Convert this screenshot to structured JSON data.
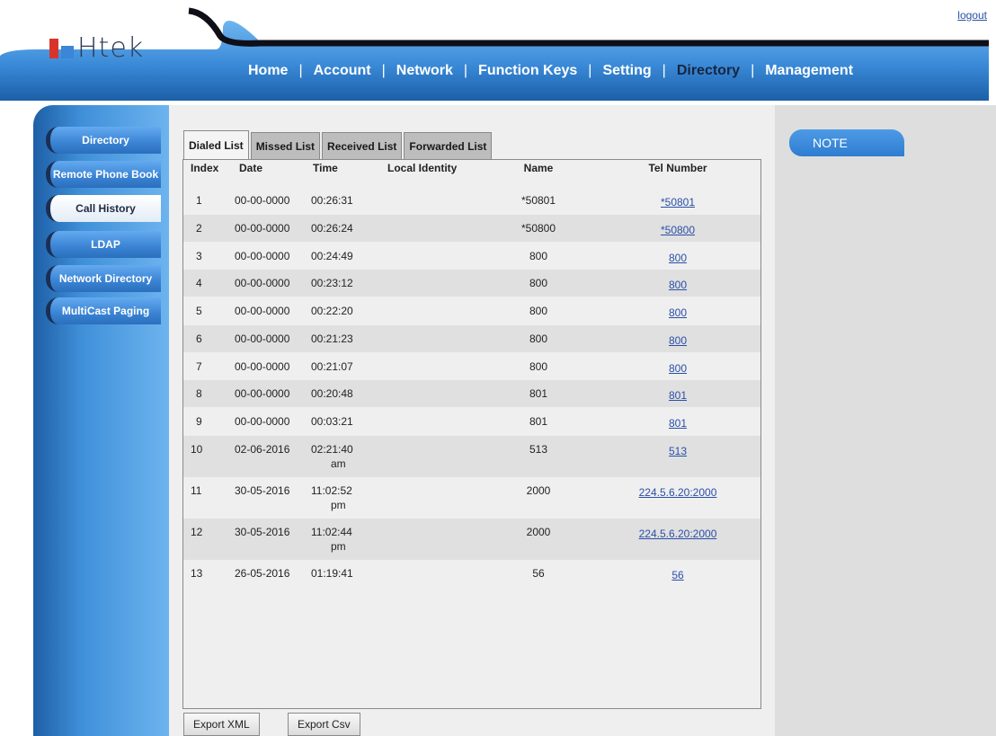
{
  "header": {
    "logo_text": "Htek",
    "logout": "logout",
    "nav": [
      {
        "label": "Home",
        "active": false
      },
      {
        "label": "Account",
        "active": false
      },
      {
        "label": "Network",
        "active": false
      },
      {
        "label": "Function Keys",
        "active": false
      },
      {
        "label": "Setting",
        "active": false
      },
      {
        "label": "Directory",
        "active": true
      },
      {
        "label": "Management",
        "active": false
      }
    ],
    "nav_separator": "|"
  },
  "sidebar": {
    "items": [
      {
        "label": "Directory",
        "active": false
      },
      {
        "label": "Remote Phone Book",
        "active": false
      },
      {
        "label": "Call History",
        "active": true
      },
      {
        "label": "LDAP",
        "active": false
      },
      {
        "label": "Network Directory",
        "active": false
      },
      {
        "label": "MultiCast Paging",
        "active": false
      }
    ]
  },
  "tabs": [
    {
      "label": "Dialed List",
      "active": true
    },
    {
      "label": "Missed List",
      "active": false
    },
    {
      "label": "Received List",
      "active": false
    },
    {
      "label": "Forwarded List",
      "active": false
    }
  ],
  "table": {
    "columns": {
      "index": "Index",
      "date": "Date",
      "time": "Time",
      "local": "Local Identity",
      "name": "Name",
      "tel": "Tel Number"
    },
    "rows": [
      {
        "index": "1",
        "date": "00-00-0000",
        "time": "00:26:31",
        "time2": "",
        "local": "",
        "name": "*50801",
        "tel": "*50801"
      },
      {
        "index": "2",
        "date": "00-00-0000",
        "time": "00:26:24",
        "time2": "",
        "local": "",
        "name": "*50800",
        "tel": "*50800"
      },
      {
        "index": "3",
        "date": "00-00-0000",
        "time": "00:24:49",
        "time2": "",
        "local": "",
        "name": "800",
        "tel": "800"
      },
      {
        "index": "4",
        "date": "00-00-0000",
        "time": "00:23:12",
        "time2": "",
        "local": "",
        "name": "800",
        "tel": "800"
      },
      {
        "index": "5",
        "date": "00-00-0000",
        "time": "00:22:20",
        "time2": "",
        "local": "",
        "name": "800",
        "tel": "800"
      },
      {
        "index": "6",
        "date": "00-00-0000",
        "time": "00:21:23",
        "time2": "",
        "local": "",
        "name": "800",
        "tel": "800"
      },
      {
        "index": "7",
        "date": "00-00-0000",
        "time": "00:21:07",
        "time2": "",
        "local": "",
        "name": "800",
        "tel": "800"
      },
      {
        "index": "8",
        "date": "00-00-0000",
        "time": "00:20:48",
        "time2": "",
        "local": "",
        "name": "801",
        "tel": "801"
      },
      {
        "index": "9",
        "date": "00-00-0000",
        "time": "00:03:21",
        "time2": "",
        "local": "",
        "name": "801",
        "tel": "801"
      },
      {
        "index": "10",
        "date": "02-06-2016",
        "time": "02:21:40",
        "time2": "am",
        "local": "",
        "name": "513",
        "tel": "513"
      },
      {
        "index": "11",
        "date": "30-05-2016",
        "time": "11:02:52",
        "time2": "pm",
        "local": "",
        "name": "2000",
        "tel": "224.5.6.20:2000"
      },
      {
        "index": "12",
        "date": "30-05-2016",
        "time": "11:02:44",
        "time2": "pm",
        "local": "",
        "name": "2000",
        "tel": "224.5.6.20:2000"
      },
      {
        "index": "13",
        "date": "26-05-2016",
        "time": "01:19:41",
        "time2": "",
        "local": "",
        "name": "56",
        "tel": "56"
      }
    ]
  },
  "buttons": {
    "export_xml": "Export XML",
    "export_csv": "Export Csv"
  },
  "note": {
    "title": "NOTE"
  },
  "colors": {
    "brand_blue": "#3f8fd8",
    "link": "#2a4fa8",
    "logo_red": "#d8352a"
  }
}
